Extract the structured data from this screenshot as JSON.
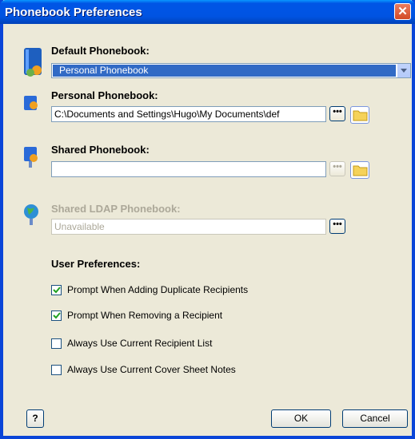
{
  "window": {
    "title": "Phonebook Preferences",
    "close_glyph": "✕"
  },
  "default_phonebook": {
    "label": "Default Phonebook:",
    "selected": "Personal Phonebook",
    "icon": "phonebook-book-icon"
  },
  "personal_phonebook": {
    "label": "Personal Phonebook:",
    "path": "C:\\Documents and Settings\\Hugo\\My Documents\\def",
    "browse_label": "•••",
    "icon": "personal-phonebook-icon"
  },
  "shared_phonebook": {
    "label": "Shared Phonebook:",
    "path": "",
    "browse_label": "•••",
    "icon": "shared-phonebook-icon"
  },
  "ldap_phonebook": {
    "label": "Shared LDAP Phonebook:",
    "value": "Unavailable",
    "browse_label": "•••",
    "icon": "ldap-globe-icon"
  },
  "user_preferences": {
    "heading": "User Preferences:",
    "options": [
      {
        "label": "Prompt When Adding Duplicate Recipients",
        "checked": true
      },
      {
        "label": "Prompt When Removing a Recipient",
        "checked": true
      },
      {
        "label": "Always Use Current Recipient List",
        "checked": false
      },
      {
        "label": "Always Use Current Cover Sheet Notes",
        "checked": false
      }
    ]
  },
  "footer": {
    "help_label": "?",
    "ok_label": "OK",
    "cancel_label": "Cancel"
  }
}
